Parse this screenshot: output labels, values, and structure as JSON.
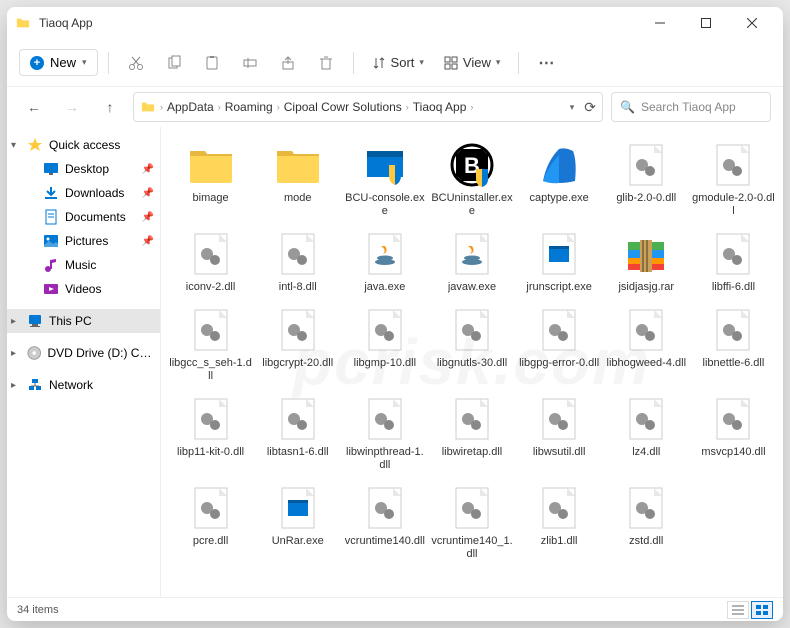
{
  "window": {
    "title": "Tiaoq App"
  },
  "toolbar": {
    "new_label": "New",
    "sort_label": "Sort",
    "view_label": "View"
  },
  "breadcrumbs": [
    "AppData",
    "Roaming",
    "Cipoal Cowr Solutions",
    "Tiaoq App"
  ],
  "search": {
    "placeholder": "Search Tiaoq App"
  },
  "sidebar": {
    "quick_access": "Quick access",
    "items": [
      {
        "label": "Desktop",
        "icon": "desktop",
        "pinned": true
      },
      {
        "label": "Downloads",
        "icon": "downloads",
        "pinned": true
      },
      {
        "label": "Documents",
        "icon": "documents",
        "pinned": true
      },
      {
        "label": "Pictures",
        "icon": "pictures",
        "pinned": true
      },
      {
        "label": "Music",
        "icon": "music",
        "pinned": false
      },
      {
        "label": "Videos",
        "icon": "videos",
        "pinned": false
      }
    ],
    "this_pc": "This PC",
    "dvd": "DVD Drive (D:) CCCC",
    "network": "Network"
  },
  "files": [
    {
      "name": "bimage",
      "type": "folder"
    },
    {
      "name": "mode",
      "type": "folder"
    },
    {
      "name": "BCU-console.exe",
      "type": "exe-shield"
    },
    {
      "name": "BCUninstaller.exe",
      "type": "bcu"
    },
    {
      "name": "captype.exe",
      "type": "shark"
    },
    {
      "name": "glib-2.0-0.dll",
      "type": "dll"
    },
    {
      "name": "gmodule-2.0-0.dll",
      "type": "dll"
    },
    {
      "name": "iconv-2.dll",
      "type": "dll"
    },
    {
      "name": "intl-8.dll",
      "type": "dll"
    },
    {
      "name": "java.exe",
      "type": "java"
    },
    {
      "name": "javaw.exe",
      "type": "java"
    },
    {
      "name": "jrunscript.exe",
      "type": "generic-exe"
    },
    {
      "name": "jsidjasjg.rar",
      "type": "rar"
    },
    {
      "name": "libffi-6.dll",
      "type": "dll"
    },
    {
      "name": "libgcc_s_seh-1.dll",
      "type": "dll"
    },
    {
      "name": "libgcrypt-20.dll",
      "type": "dll"
    },
    {
      "name": "libgmp-10.dll",
      "type": "dll"
    },
    {
      "name": "libgnutls-30.dll",
      "type": "dll"
    },
    {
      "name": "libgpg-error-0.dll",
      "type": "dll"
    },
    {
      "name": "libhogweed-4.dll",
      "type": "dll"
    },
    {
      "name": "libnettle-6.dll",
      "type": "dll"
    },
    {
      "name": "libp11-kit-0.dll",
      "type": "dll"
    },
    {
      "name": "libtasn1-6.dll",
      "type": "dll"
    },
    {
      "name": "libwinpthread-1.dll",
      "type": "dll"
    },
    {
      "name": "libwiretap.dll",
      "type": "dll"
    },
    {
      "name": "libwsutil.dll",
      "type": "dll"
    },
    {
      "name": "lz4.dll",
      "type": "dll"
    },
    {
      "name": "msvcp140.dll",
      "type": "dll"
    },
    {
      "name": "pcre.dll",
      "type": "dll"
    },
    {
      "name": "UnRar.exe",
      "type": "generic-exe"
    },
    {
      "name": "vcruntime140.dll",
      "type": "dll"
    },
    {
      "name": "vcruntime140_1.dll",
      "type": "dll"
    },
    {
      "name": "zlib1.dll",
      "type": "dll"
    },
    {
      "name": "zstd.dll",
      "type": "dll"
    }
  ],
  "status": {
    "count": "34 items"
  },
  "watermark": "pcrisk.com"
}
